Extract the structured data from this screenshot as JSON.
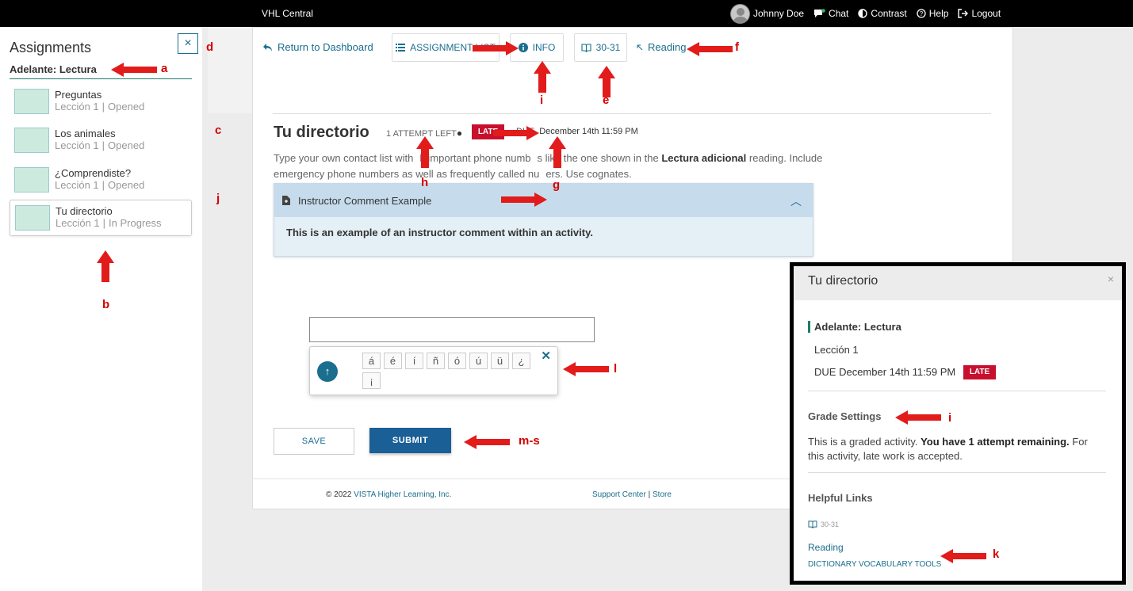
{
  "topbar": {
    "brand": "VHL Central",
    "user_name": "Johnny Doe",
    "chat": "Chat",
    "contrast": "Contrast",
    "help": "Help",
    "logout": "Logout"
  },
  "sidebar": {
    "title": "Assignments",
    "close": "×",
    "unit": "Adelante: Lectura",
    "items": [
      {
        "name": "Preguntas",
        "lesson": "Lección 1",
        "sep": "|",
        "status": "Opened"
      },
      {
        "name": "Los animales",
        "lesson": "Lección 1",
        "sep": "|",
        "status": "Opened"
      },
      {
        "name": "¿Comprendiste?",
        "lesson": "Lección 1",
        "sep": "|",
        "status": "Opened"
      },
      {
        "name": "Tu directorio",
        "lesson": "Lección 1",
        "sep": "|",
        "status": "In Progress"
      }
    ]
  },
  "nav": {
    "return": "Return to Dashboard",
    "assignment_list": "ASSIGNMENT LIST",
    "info": "INFO",
    "pages": "30-31",
    "reading": "Reading"
  },
  "activity": {
    "title": "Tu directorio",
    "attempts": "1 ATTEMPT LEFT",
    "late": "LATE",
    "due_label": "DUE",
    "due_date": "December 14th 11:59 PM",
    "desc_1": "Type your own contact list with",
    "desc_2": "k important phone numb",
    "desc_3": "s like the one shown in the ",
    "desc_bold": "Lectura adicional",
    "desc_4": " reading. Include",
    "desc_line2a": "emergency phone numbers as well as frequently called nu",
    "desc_line2b": "ers. Use cognates.",
    "comment_title": "Instructor Comment Example",
    "comment_body": "This is an example of an instructor comment within an activity.",
    "accent_keys": [
      "á",
      "é",
      "í",
      "ñ",
      "ó",
      "ú",
      "ü",
      "¿",
      "¡"
    ],
    "save": "SAVE",
    "submit": "SUBMIT"
  },
  "footer": {
    "copyright_prefix": "© 2022 ",
    "company": "VISTA Higher Learning, Inc.",
    "support": "Support Center",
    "divider": "|",
    "store": "Store"
  },
  "info_panel": {
    "title": "Tu directorio",
    "close": "×",
    "unit": "Adelante: Lectura",
    "lesson": "Lección 1",
    "due_label": "DUE",
    "due_date": "December 14th 11:59 PM",
    "late": "LATE",
    "grade_heading": "Grade Settings",
    "grade_text_1": "This is a graded activity. ",
    "grade_text_bold": "You have 1 attempt remaining.",
    "grade_text_2": " For",
    "grade_text_3": "this activity, late work is accepted.",
    "links_heading": "Helpful Links",
    "pages": "30-31",
    "reading": "Reading",
    "dictionary": "DICTIONARY",
    "vocab": "VOCABULARY TOOLS"
  },
  "annotations": {
    "a": "a",
    "b": "b",
    "c": "c",
    "d": "d",
    "e": "e",
    "f": "f",
    "g": "g",
    "h": "h",
    "i": "i",
    "j": "j",
    "k": "k",
    "l": "l",
    "ms": "m-s",
    "i2": "i"
  },
  "colors": {
    "accent": "#1a6e8e",
    "late": "#c8102e",
    "annotation": "#e21b1b",
    "submit": "#1a5f96"
  }
}
